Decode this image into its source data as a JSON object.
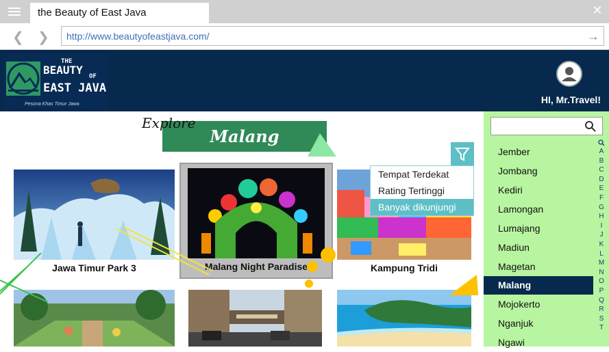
{
  "browser": {
    "tab_title": "the Beauty of East Java",
    "url": "http://www.beautyofeastjava.com/",
    "back_glyph": "❮",
    "forward_glyph": "❯",
    "go_glyph": "→",
    "close_glyph": "✕"
  },
  "header": {
    "logo": {
      "the": "THE",
      "beauty": "BEAUTY",
      "of": "OF",
      "east_java": "EAST JAVA",
      "tagline": "Pesona Khas Timur Jawa"
    },
    "greeting": "HI, Mr.Travel!"
  },
  "explore": {
    "label": "Explore",
    "city": "Malang"
  },
  "cards": [
    {
      "caption": "Jawa Timur Park 3",
      "icon": "snow-leopard-statue-photo"
    },
    {
      "caption": "Malang Night Paradise",
      "icon": "lantern-gate-photo"
    },
    {
      "caption": "Kampung Tridi",
      "icon": "colorful-village-photo"
    },
    {
      "caption": "",
      "icon": "garden-photo"
    },
    {
      "caption": "",
      "icon": "street-photo"
    },
    {
      "caption": "",
      "icon": "beach-photo"
    }
  ],
  "filter": {
    "icon": "funnel-icon",
    "options": [
      "Tempat Terdekat",
      "Rating Tertinggi",
      "Banyak dikunjungi"
    ],
    "selected_index": 2
  },
  "sidebar": {
    "search_placeholder": "",
    "cities": [
      "Jember",
      "Jombang",
      "Kediri",
      "Lamongan",
      "Lumajang",
      "Madiun",
      "Magetan",
      "Malang",
      "Mojokerto",
      "Nganjuk",
      "Ngawi"
    ],
    "selected_city": "Malang",
    "alphabet": [
      "A",
      "B",
      "C",
      "D",
      "E",
      "F",
      "G",
      "H",
      "I",
      "J",
      "K",
      "L",
      "M",
      "N",
      "O",
      "P",
      "Q",
      "R",
      "S",
      "T"
    ]
  },
  "colors": {
    "header_bg": "#06294d",
    "accent_green": "#2f8a57",
    "sidebar_bg": "#b8f5a0",
    "filter_teal": "#5ebfc7",
    "yellow": "#ffc000"
  }
}
